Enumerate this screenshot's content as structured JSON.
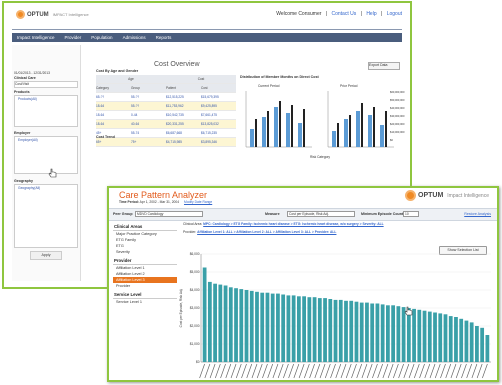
{
  "back_window": {
    "brand": "OPTUM",
    "product": "IMPACT Intelligence",
    "header_links": [
      "Welcome Consumer",
      "|",
      "Contact Us",
      "|",
      "Help",
      "|",
      "Logout"
    ],
    "nav": [
      "Impact Intelligence",
      "Provider",
      "Population",
      "Admissions",
      "Reports"
    ],
    "filter": {
      "date_range": "01/01/2013 - 12/31/2013",
      "clinical_label": "Clinical Care",
      "clinical_value": "Cost/Visit",
      "products_label": "Products",
      "products_item": "Products(All)",
      "employer_label": "Employer",
      "employer_item": "Employer(All)",
      "geography_label": "Geography",
      "geography_item": "Geography(All)",
      "apply_label": "Apply"
    },
    "title": "Cost Overview",
    "export_label": "Export Data",
    "table_title": "Cost By Age and Gender",
    "table_group_headers": [
      "Age",
      "Cost"
    ],
    "table_headers": [
      "Category",
      "Group",
      "Patient",
      "Cost"
    ],
    "table_rows": [
      [
        "65-??",
        "55-??",
        "$12,515,225",
        "$15,679,395"
      ],
      [
        "18-64",
        "55-??",
        "$11,753,962",
        "$9,425,895"
      ],
      [
        "18-64",
        "0-44",
        "$10,542,735",
        "$7,661,475"
      ],
      [
        "18-64",
        "40-64",
        "$20,331,255",
        "$13,825,032"
      ],
      [
        "45+",
        "55-74",
        "$6,687,668",
        "$6,715,235"
      ],
      [
        "65+",
        "75+",
        "$4,715,985",
        "$3,895,346"
      ]
    ],
    "cost_trend_label": "Cost Trend",
    "charts_title": "Distribution of Member Months on Direct Cost",
    "chart_left_title": "Current Period",
    "chart_right_title": "Prior Period",
    "chart_axis": "Risk Category",
    "chart_ticks": [
      "$60,000,000",
      "$50,000,000",
      "$40,000,000",
      "$30,000,000",
      "$20,000,000",
      "$10,000,000",
      "$0"
    ]
  },
  "front_window": {
    "brand": "OPTUM",
    "product": "Impact Intelligence",
    "title": "Care Pattern Analyzer",
    "time_period_label": "Time Period:",
    "time_period_value": "Apr 1, 2002 - Mar 31, 2004",
    "modify_link": "Modify Date Range",
    "peer_group_label": "Peer Group",
    "peer_group_value": "MDVD Cardiology",
    "measure_label": "Measure",
    "measure_value": "Cost per Episode, Risk Adj.",
    "min_episode_label": "Minimum Episode Count:",
    "min_episode_value": "10",
    "restore_link": "Restore Analysis",
    "sidebar": [
      {
        "header": "Clinical Areas",
        "items": [
          "Major Practice Category",
          "ETG Family",
          "ETG",
          "Severity"
        ]
      },
      {
        "header": "Provider",
        "items": [
          "Affiliation Level 1",
          "Affiliation Level 2",
          "Affiliation Level 3",
          "Provider"
        ],
        "active": 2
      },
      {
        "header": "Service Level",
        "items": [
          "Service Level 1"
        ]
      }
    ],
    "crumb_clinical_label": "Clinical Area:",
    "crumb_clinical": "MPC: Cardiology > ETG Family: Ischemic heart disease > ETG: Ischemic heart disease, w/o surgery > Severity: ALL",
    "crumb_provider_label": "Provider:",
    "crumb_provider": "Affiliation Level 1: ALL > Affiliation Level 2: ALL > Affiliation Level 3: ALL > Provider: ALL",
    "show_selection": "Show Selection List"
  },
  "chart_data": {
    "type": "bar",
    "title": "",
    "xlabel": "",
    "ylabel": "Cost per Episode, Risk Adj.",
    "ylim": [
      0,
      6000
    ],
    "y_ticks": [
      "$0",
      "$1,000",
      "$2,000",
      "$3,000",
      "$4,000",
      "$5,000",
      "$6,000"
    ],
    "values": [
      5250,
      4450,
      4350,
      4300,
      4250,
      4150,
      4100,
      4050,
      4000,
      3950,
      3900,
      3850,
      3850,
      3800,
      3800,
      3750,
      3700,
      3700,
      3650,
      3650,
      3600,
      3600,
      3550,
      3550,
      3500,
      3450,
      3450,
      3400,
      3400,
      3350,
      3300,
      3300,
      3250,
      3250,
      3200,
      3150,
      3150,
      3100,
      3050,
      3000,
      2950,
      2900,
      2850,
      2800,
      2750,
      2700,
      2650,
      2550,
      2500,
      2400,
      2300,
      2200,
      2000,
      1900,
      1500
    ],
    "bar_color": "#3aa0a8"
  }
}
